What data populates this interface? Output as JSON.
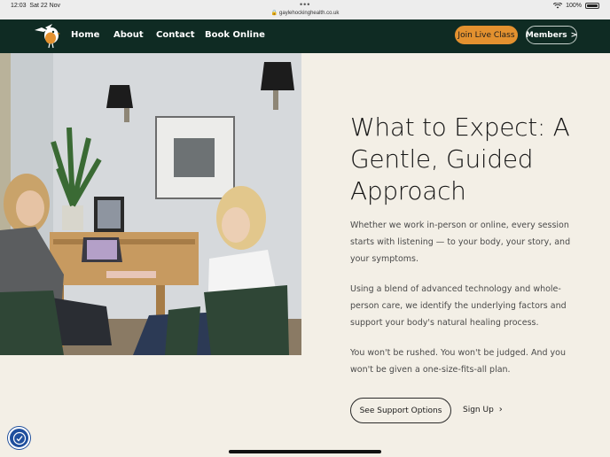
{
  "status": {
    "time": "12:03",
    "date": "Sat 22 Nov",
    "url": "gaylehockinghealth.co.uk",
    "battery": "100%"
  },
  "nav": {
    "links": [
      "Home",
      "About",
      "Contact",
      "Book Online"
    ],
    "join_label": "Join Live Class",
    "members_label": "Members",
    "accent": "#e3912f",
    "background": "#0f2b23"
  },
  "main": {
    "heading": "What to Expect: A Gentle, Guided Approach",
    "paragraphs": [
      "Whether we work in-person or online, every session starts with listening — to your body, your story, and your symptoms.",
      "Using a blend of advanced technology and whole-person care, we identify the underlying factors and support your body's natural healing process.",
      "You won't be rushed. You won't be judged. And you won't be given a one-size-fits-all plan."
    ],
    "support_button": "See Support Options",
    "signup_link": "Sign Up"
  }
}
